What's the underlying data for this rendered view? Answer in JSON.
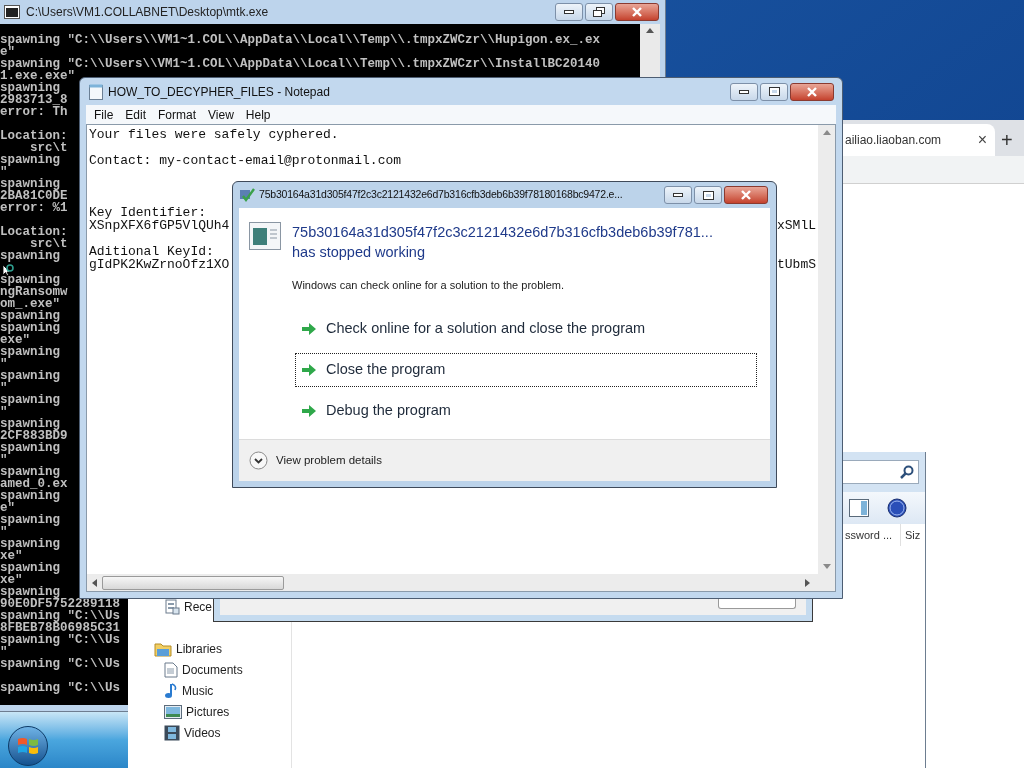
{
  "browser": {
    "tab_title": "ailiao.liaoban.com",
    "tab_close": "×",
    "new_tab": "+"
  },
  "console": {
    "title": "C:\\Users\\VM1.COLLABNET\\Desktop\\mtk.exe",
    "lines": [
      {
        "text": "spawning \"C:\\\\Users\\\\VM1~1.COL\\\\AppData\\\\Local\\\\Temp\\\\.tmpxZWCzr\\\\Hupigon.ex_.ex",
        "blank_after": false
      },
      {
        "text": "e\"",
        "blank_after": false
      },
      {
        "text": "spawning \"C:\\\\Users\\\\VM1~1.COL\\\\AppData\\\\Local\\\\Temp\\\\.tmpxZWCzr\\\\InstallBC20140",
        "blank_after": false
      },
      {
        "text": "1.exe.exe\"",
        "blank_after": false
      },
      {
        "text": "spawning",
        "blank_after": false
      },
      {
        "text": "2983713_8",
        "blank_after": false
      },
      {
        "text": "error: Th",
        "blank_after": true
      },
      {
        "text": "Location:",
        "blank_after": false
      },
      {
        "text": "    src\\t",
        "blank_after": false
      },
      {
        "text": "spawning",
        "blank_after": false
      },
      {
        "text": "\"",
        "blank_after": false
      },
      {
        "text": "spawning",
        "blank_after": false
      },
      {
        "text": "2BA81C0DE",
        "blank_after": false
      },
      {
        "text": "error: %1",
        "blank_after": true
      },
      {
        "text": "Location:",
        "blank_after": false
      },
      {
        "text": "    src\\t",
        "blank_after": false
      },
      {
        "text": "spawning",
        "blank_after": true
      },
      {
        "text": "spawning",
        "blank_after": false
      },
      {
        "text": "ngRansomw",
        "blank_after": false
      },
      {
        "text": "om_.exe\"",
        "blank_after": false
      },
      {
        "text": "spawning",
        "blank_after": false
      },
      {
        "text": "spawning",
        "blank_after": false
      },
      {
        "text": "exe\"",
        "blank_after": false
      },
      {
        "text": "spawning",
        "blank_after": false
      },
      {
        "text": "\"",
        "blank_after": false
      },
      {
        "text": "spawning",
        "blank_after": false
      },
      {
        "text": "\"",
        "blank_after": false
      },
      {
        "text": "spawning",
        "blank_after": false
      },
      {
        "text": "\"",
        "blank_after": false
      },
      {
        "text": "spawning",
        "blank_after": false
      },
      {
        "text": "2CF883BD9",
        "blank_after": false
      },
      {
        "text": "spawning",
        "blank_after": false
      },
      {
        "text": "\"",
        "blank_after": false
      },
      {
        "text": "spawning",
        "blank_after": false
      },
      {
        "text": "amed_0.ex",
        "blank_after": false
      },
      {
        "text": "spawning",
        "blank_after": false
      },
      {
        "text": "e\"",
        "blank_after": false
      },
      {
        "text": "spawning",
        "blank_after": false
      },
      {
        "text": "\"",
        "blank_after": false
      },
      {
        "text": "spawning",
        "blank_after": false
      },
      {
        "text": "xe\"",
        "blank_after": false
      },
      {
        "text": "spawning",
        "blank_after": false
      },
      {
        "text": "xe\"",
        "blank_after": false
      },
      {
        "text": "spawning",
        "blank_after": false
      },
      {
        "text": "90E0DF5752289118",
        "blank_after": false
      },
      {
        "text": "spawning \"C:\\\\Us",
        "blank_after": false
      },
      {
        "text": "8FBEB78B06985C31",
        "blank_after": false
      },
      {
        "text": "spawning \"C:\\\\Us",
        "blank_after": false
      },
      {
        "text": "\"",
        "blank_after": false
      },
      {
        "text": "spawning \"C:\\\\Us",
        "blank_after": true
      },
      {
        "text": "spawning \"C:\\\\Us",
        "blank_after": false
      }
    ]
  },
  "explorer": {
    "columns": [
      "ssword ...",
      "Siz"
    ],
    "nav": [
      {
        "label": "Rece",
        "kind": "recent"
      },
      {
        "label": "Libraries",
        "kind": "library",
        "children": [
          {
            "label": "Documents",
            "kind": "documents"
          },
          {
            "label": "Music",
            "kind": "music"
          },
          {
            "label": "Pictures",
            "kind": "pictures"
          },
          {
            "label": "Videos",
            "kind": "videos"
          }
        ]
      }
    ]
  },
  "notepad": {
    "title": "HOW_TO_DECYPHER_FILES - Notepad",
    "menu": [
      "File",
      "Edit",
      "Format",
      "View",
      "Help"
    ],
    "lines": [
      {
        "text": "Your files were safely cyphered.",
        "blank_after": true,
        "extra_blank": false
      },
      {
        "text": "Contact: my-contact-email@protonmail.com",
        "blank_after": true,
        "extra_blank": true
      },
      {
        "text": "Key Identifier:",
        "blank_after": false,
        "extra_blank": false
      },
      {
        "text": "XSnpXFX6fGP5VlQUh4",
        "tail": "xSMlL",
        "blank_after": true,
        "extra_blank": false
      },
      {
        "text": "Aditional KeyId:",
        "blank_after": false,
        "extra_blank": false
      },
      {
        "text": "gIdPK2KwZrnoOfz1XO",
        "tail": "tUbmS",
        "blank_after": false,
        "extra_blank": false
      }
    ]
  },
  "dialog": {
    "title": "75b30164a31d305f47f2c3c2121432e6d7b316cfb3deb6b39f78180168bc9472.e...",
    "app_name": "75b30164a31d305f47f2c3c2121432e6d7b316cfb3deb6b39f781...",
    "status": "has stopped working",
    "message": "Windows can check online for a solution to the problem.",
    "options": [
      {
        "label": "Check online for a solution and close the program",
        "focused": false
      },
      {
        "label": "Close the program",
        "focused": true
      },
      {
        "label": "Debug the program",
        "focused": false
      }
    ],
    "details": "View problem details"
  }
}
